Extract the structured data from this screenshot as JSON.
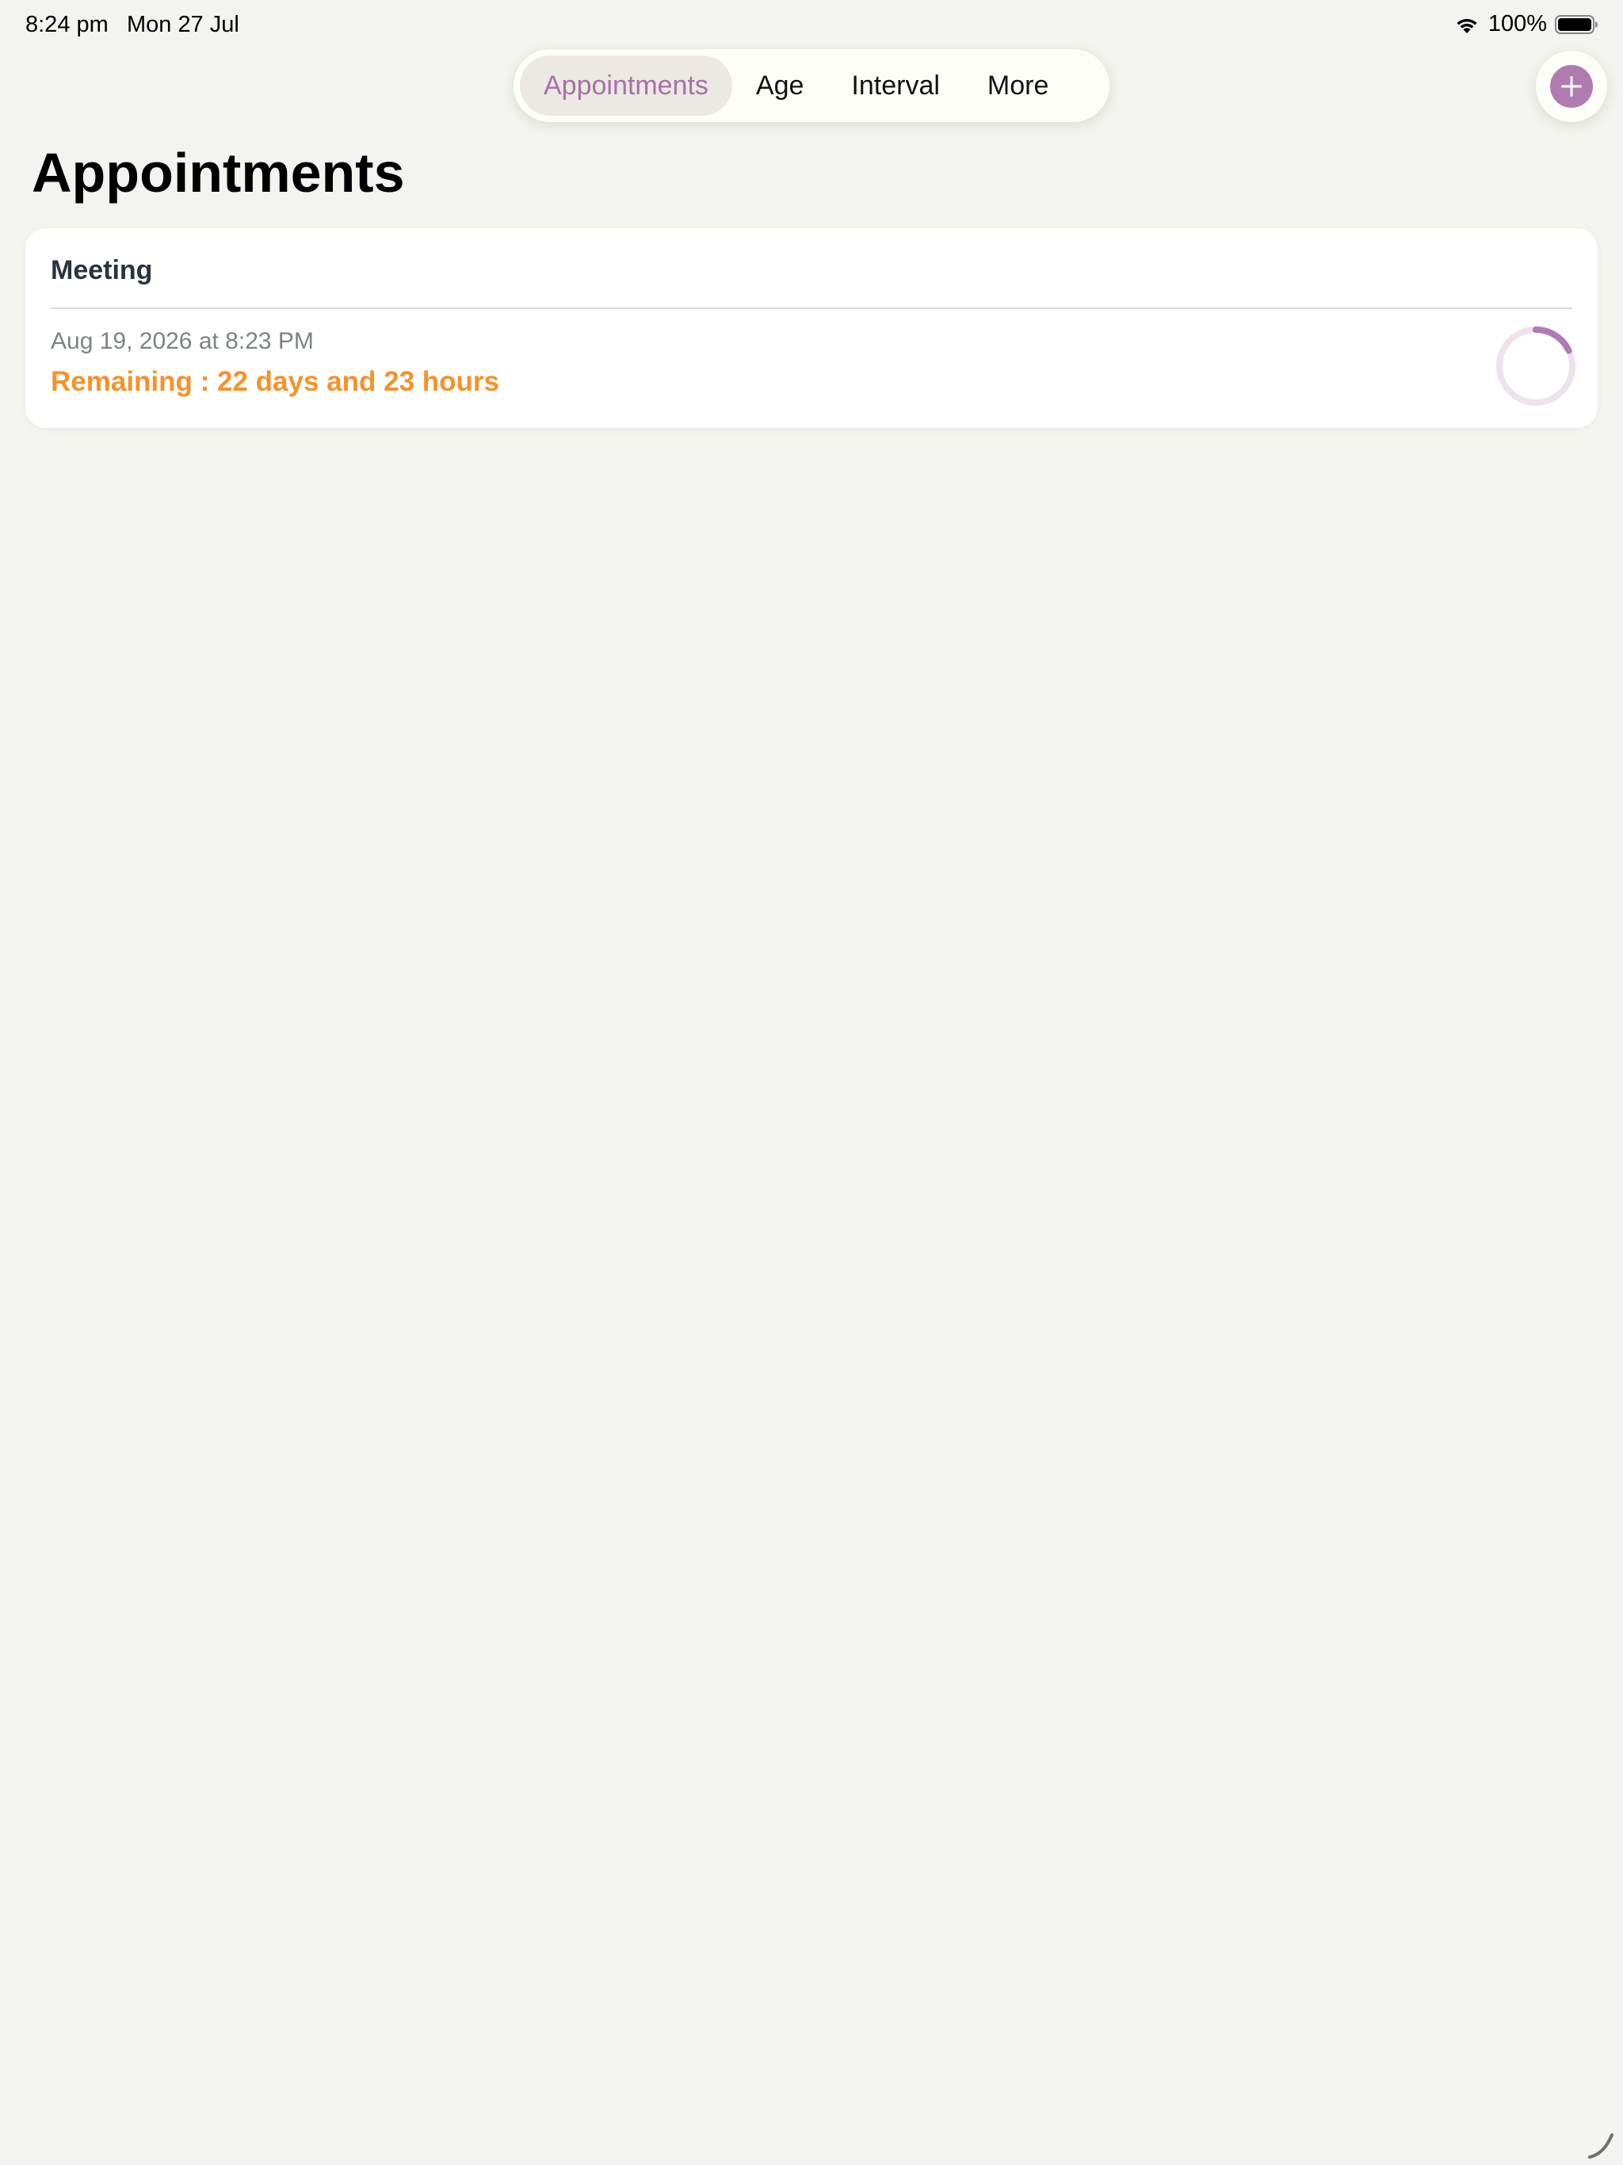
{
  "status_bar": {
    "time": "8:24 pm",
    "date": "Mon 27 Jul",
    "battery_percent": "100%",
    "wifi_icon": "wifi-icon",
    "battery_icon": "battery-icon"
  },
  "tabs": [
    {
      "label": "Appointments",
      "active": true
    },
    {
      "label": "Age",
      "active": false
    },
    {
      "label": "Interval",
      "active": false
    },
    {
      "label": "More",
      "active": false
    }
  ],
  "add_button": {
    "icon": "plus-icon",
    "color": "#b07bb1"
  },
  "page": {
    "title": "Appointments"
  },
  "appointments": [
    {
      "title": "Meeting",
      "datetime": "Aug 19, 2026 at 8:23 PM",
      "remaining": "Remaining : 22 days and 23 hours",
      "progress": 0.18
    }
  ],
  "colors": {
    "background": "#f3f4ef",
    "accent": "#b07bb1",
    "remaining_text": "#f5922a",
    "ring_track": "#efe2ee"
  }
}
